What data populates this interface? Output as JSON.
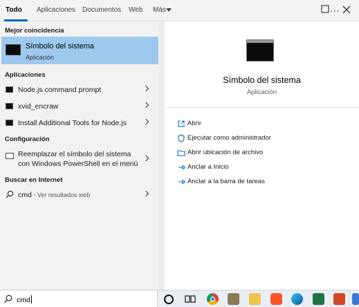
{
  "tabs": [
    {
      "label": "Todo",
      "active": true
    },
    {
      "label": "Aplicaciones"
    },
    {
      "label": "Documentos"
    },
    {
      "label": "Web"
    },
    {
      "label": "Más"
    }
  ],
  "top_icons": [
    "feedback-icon",
    "more-options-icon",
    "close-icon"
  ],
  "left": {
    "best_match_heading": "Mejor coincidencia",
    "best_match": {
      "title": "Símbolo del sistema",
      "subtitle": "Aplicación",
      "icon": "command-prompt-icon"
    },
    "apps_heading": "Aplicaciones",
    "apps": [
      {
        "label": "Node.js command prompt",
        "icon": "command-prompt-icon"
      },
      {
        "label": "xvid_encraw",
        "icon": "command-prompt-icon"
      },
      {
        "label": "Install Additional Tools for Node.js",
        "icon": "command-prompt-icon"
      }
    ],
    "settings_heading": "Configuración",
    "setting": {
      "line1": "Reemplazar el símbolo del sistema",
      "line2": "con Windows PowerShell en el menú",
      "icon": "monitor-icon"
    },
    "web_heading": "Buscar en Internet",
    "web": {
      "query": "cmd",
      "hint": " - Ver resultados web",
      "icon": "search-icon"
    }
  },
  "right": {
    "title": "Símbolo del sistema",
    "subtitle": "Aplicación",
    "actions": [
      {
        "label": "Abrir",
        "icon": "open-icon"
      },
      {
        "label": "Ejecutar como administrador",
        "icon": "shield-icon"
      },
      {
        "label": "Abrir ubicación de archivo",
        "icon": "folder-icon"
      },
      {
        "label": "Anclar a Inicio",
        "icon": "pin-icon"
      },
      {
        "label": "Anclar a la barra de tareas",
        "icon": "pin-icon"
      }
    ]
  },
  "search": {
    "value": "cmd"
  },
  "taskbar": {
    "icons": [
      "cortana-icon",
      "task-view-icon",
      "chrome-icon",
      "gimp-icon",
      "file-explorer-icon",
      "brave-icon",
      "edge-icon",
      "excel-icon",
      "powerpoint-icon",
      "explorer-icon"
    ],
    "colors": {
      "accent": "#0067c0",
      "selection": "#9ec9ee"
    }
  }
}
